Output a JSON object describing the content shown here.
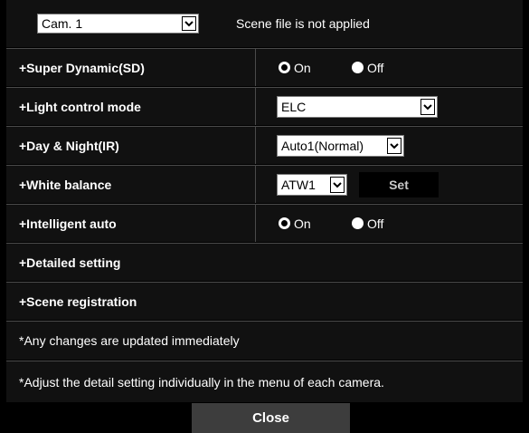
{
  "header": {
    "camera_select": "Cam. 1",
    "scene_status": "Scene file is not applied"
  },
  "rows": {
    "super_dynamic": {
      "label": "+Super Dynamic(SD)",
      "on_label": "On",
      "off_label": "Off",
      "selected": "On"
    },
    "light_control": {
      "label": "+Light control mode",
      "value": "ELC"
    },
    "day_night": {
      "label": "+Day & Night(IR)",
      "value": "Auto1(Normal)"
    },
    "white_balance": {
      "label": "+White balance",
      "value": "ATW1",
      "set_label": "Set"
    },
    "intelligent_auto": {
      "label": "+Intelligent auto",
      "on_label": "On",
      "off_label": "Off",
      "selected": "On"
    },
    "detailed_setting": {
      "label": "+Detailed setting"
    },
    "scene_registration": {
      "label": "+Scene registration"
    }
  },
  "notes": {
    "note1": "*Any changes are updated immediately",
    "note2": "*Adjust the detail setting individually in the menu of each camera."
  },
  "footer": {
    "close_label": "Close"
  },
  "colors": {
    "background": "#000000",
    "row_background": "#111111",
    "divider": "#4a4a4a",
    "close_button": "#3d3d3d"
  }
}
